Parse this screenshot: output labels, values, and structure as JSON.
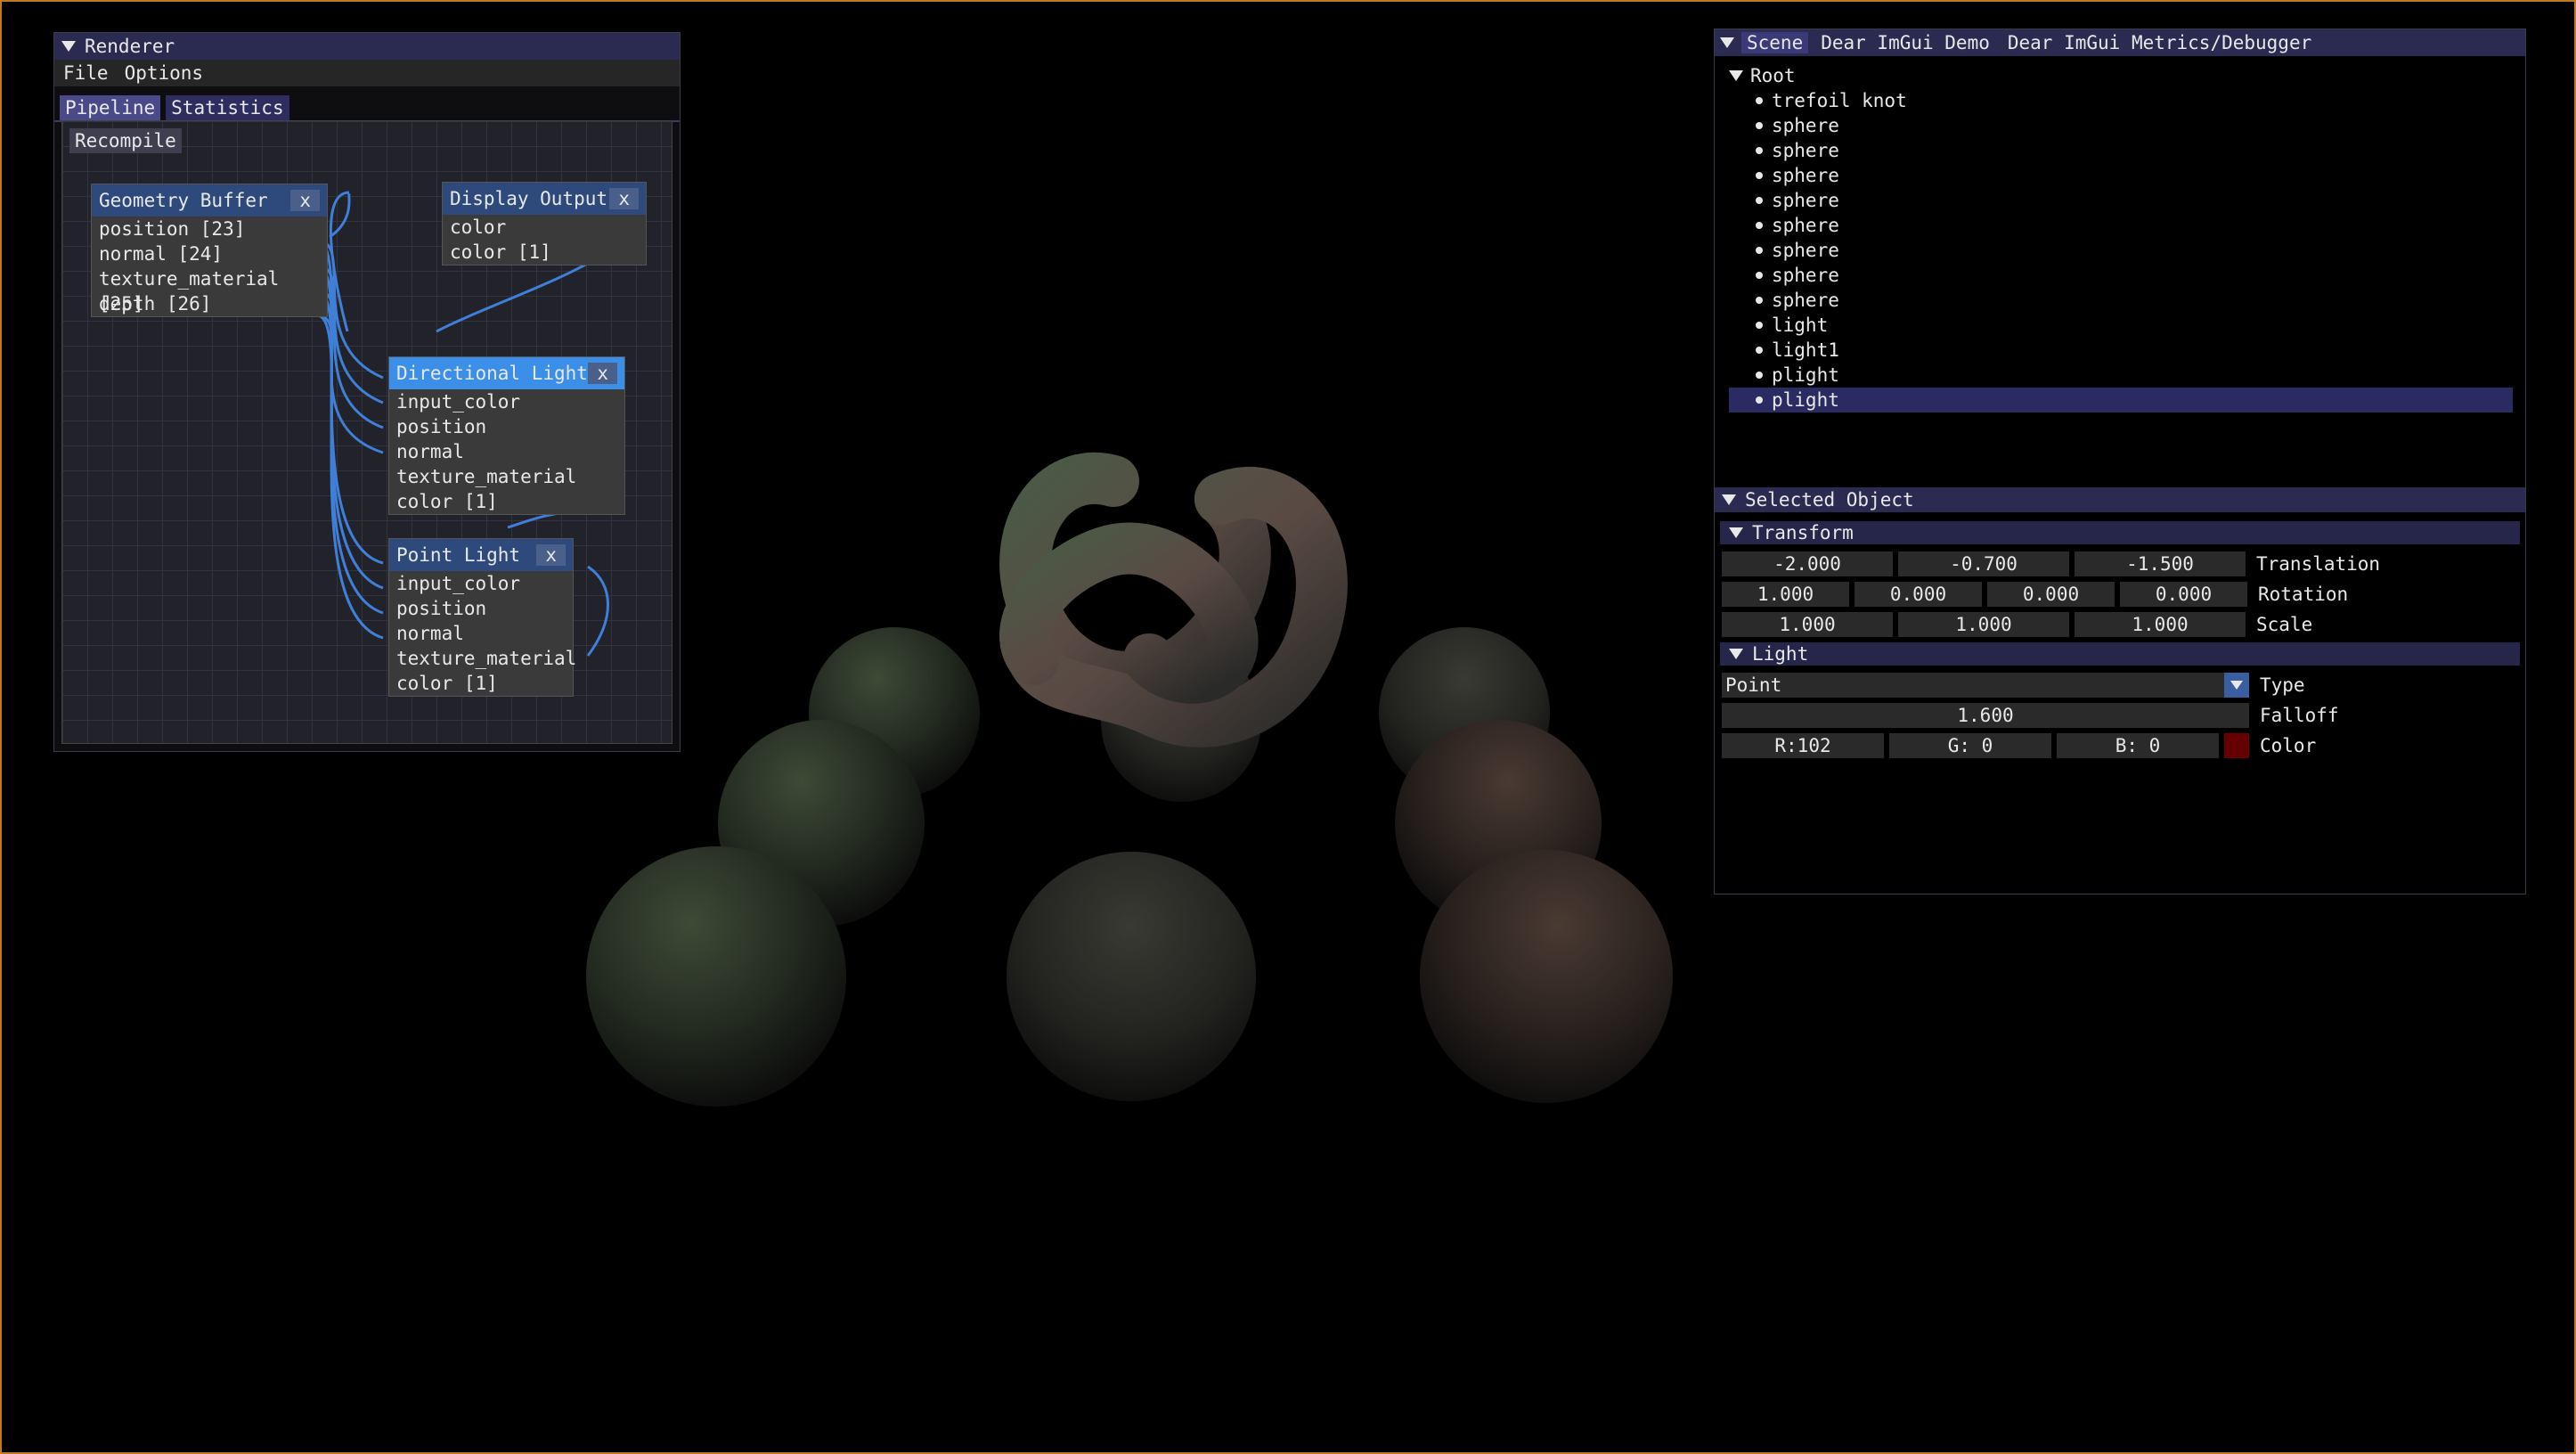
{
  "colors": {
    "frame": "#c07a1c",
    "titlebar": "#2b2b52",
    "node_header": "#2e4a7c",
    "node_header_selected": "#3b8fe8",
    "wire": "#3f7fd8",
    "light_color": "#660000"
  },
  "renderer": {
    "title": "Renderer",
    "menu": [
      "File",
      "Options"
    ],
    "tabs": [
      "Pipeline",
      "Statistics"
    ],
    "recompile_label": "Recompile",
    "nodes": {
      "geometry_buffer": {
        "title": "Geometry Buffer",
        "close": "x",
        "pins": [
          "position [23]",
          "normal [24]",
          "texture_material [25]",
          "depth [26]"
        ]
      },
      "display_output": {
        "title": "Display Output",
        "close": "x",
        "pins": [
          "color",
          "color [1]"
        ]
      },
      "directional_light": {
        "title": "Directional Light",
        "close": "x",
        "pins": [
          "input_color",
          "position",
          "normal",
          "texture_material",
          "color [1]"
        ]
      },
      "point_light": {
        "title": "Point Light",
        "close": "x",
        "pins": [
          "input_color",
          "position",
          "normal",
          "texture_material",
          "color [1]"
        ]
      }
    }
  },
  "scene": {
    "tabs": [
      "Scene",
      "Dear ImGui Demo",
      "Dear ImGui Metrics/Debugger"
    ],
    "root_label": "Root",
    "items": [
      "trefoil knot",
      "sphere",
      "sphere",
      "sphere",
      "sphere",
      "sphere",
      "sphere",
      "sphere",
      "sphere",
      "light",
      "light1",
      "plight",
      "plight"
    ],
    "selected_index": 12
  },
  "selected_object": {
    "title": "Selected Object",
    "transform": {
      "title": "Transform",
      "translation": [
        "-2.000",
        "-0.700",
        "-1.500"
      ],
      "translation_label": "Translation",
      "rotation": [
        "1.000",
        "0.000",
        "0.000",
        "0.000"
      ],
      "rotation_label": "Rotation",
      "scale": [
        "1.000",
        "1.000",
        "1.000"
      ],
      "scale_label": "Scale"
    },
    "light": {
      "title": "Light",
      "type_value": "Point",
      "type_label": "Type",
      "falloff_value": "1.600",
      "falloff_label": "Falloff",
      "color_r": "R:102",
      "color_g": "G:  0",
      "color_b": "B:  0",
      "color_label": "Color"
    }
  }
}
